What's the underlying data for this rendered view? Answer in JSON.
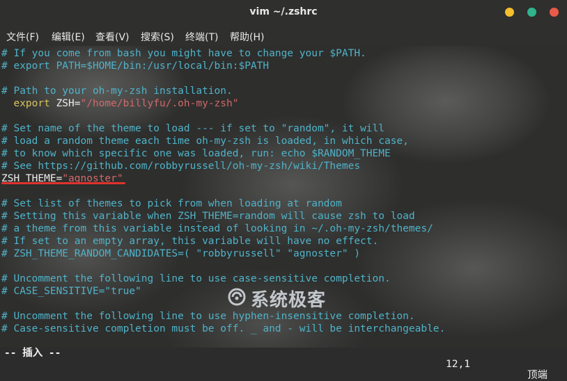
{
  "window": {
    "title": "vim ~/.zshrc",
    "colors": {
      "minimize": "#f4bf2b",
      "maximize": "#2fb48c",
      "close": "#e95a48"
    }
  },
  "menu": {
    "items": [
      "文件(F)",
      "编辑(E)",
      "查看(V)",
      "搜索(S)",
      "终端(T)",
      "帮助(H)"
    ]
  },
  "editor": {
    "colors": {
      "comment": "#4fb3c8",
      "keyword": "#d9c35a",
      "string": "#d06a6a",
      "text": "#ececec",
      "highlight_underline": "#e0332e"
    },
    "lines": [
      {
        "text": "# If you come from bash you might have to change your $PATH."
      },
      {
        "text": "# export PATH=$HOME/bin:/usr/local/bin:$PATH"
      },
      {
        "text": "# Path to your oh-my-zsh installation."
      },
      {
        "kw": "  export",
        "plain": " ZSH=",
        "str": "\"/home/billyfu/.oh-my-zsh\""
      },
      {
        "text": "# Set name of the theme to load --- if set to \"random\", it will"
      },
      {
        "text": "# load a random theme each time oh-my-zsh is loaded, in which case,"
      },
      {
        "text": "# to know which specific one was loaded, run: echo $RANDOM_THEME"
      },
      {
        "text": "# See https://github.com/robbyrussell/oh-my-zsh/wiki/Themes"
      },
      {
        "plain": "ZSH_THEME=",
        "str": "\"agnoster\""
      },
      {
        "text": "# Set list of themes to pick from when loading at random"
      },
      {
        "text": "# Setting this variable when ZSH_THEME=random will cause zsh to load"
      },
      {
        "text": "# a theme from this variable instead of looking in ~/.oh-my-zsh/themes/"
      },
      {
        "text": "# If set to an empty array, this variable will have no effect."
      },
      {
        "text": "# ZSH_THEME_RANDOM_CANDIDATES=( \"robbyrussell\" \"agnoster\" )"
      },
      {
        "text": "# Uncomment the following line to use case-sensitive completion."
      },
      {
        "text": "# CASE_SENSITIVE=\"true\""
      },
      {
        "text": "# Uncomment the following line to use hyphen-insensitive completion."
      },
      {
        "text": "# Case-sensitive completion must be off. _ and - will be interchangeable."
      }
    ]
  },
  "statusline": {
    "mode": "-- 插入 --",
    "position": "12,1",
    "scroll": "顶端"
  },
  "watermark": {
    "text": "系统极客"
  }
}
